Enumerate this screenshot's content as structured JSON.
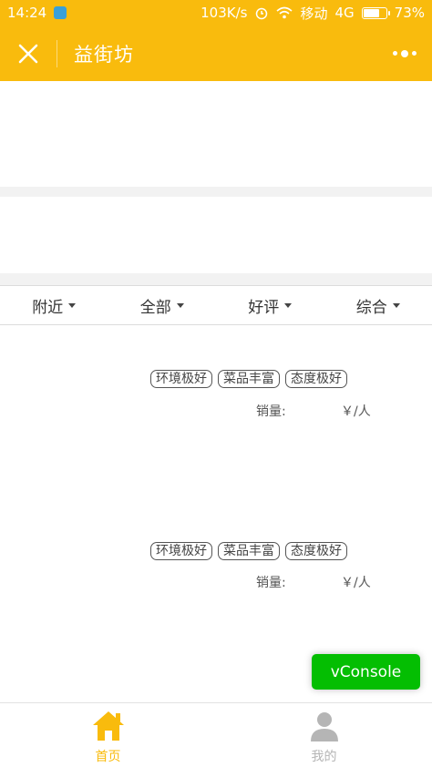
{
  "status_bar": {
    "time": "14:24",
    "net_speed": "103K/s",
    "carrier": "移动",
    "network": "4G",
    "battery_percent": 73,
    "battery_text": "73%"
  },
  "header": {
    "title": "益街坊"
  },
  "filters": [
    {
      "label": "附近"
    },
    {
      "label": "全部"
    },
    {
      "label": "好评"
    },
    {
      "label": "综合"
    }
  ],
  "shops": [
    {
      "tags": [
        "环境极好",
        "菜品丰富",
        "态度极好"
      ],
      "sales_label": "销量:",
      "price_label": "￥/人"
    },
    {
      "tags": [
        "环境极好",
        "菜品丰富",
        "态度极好"
      ],
      "sales_label": "销量:",
      "price_label": "￥/人"
    }
  ],
  "vconsole": {
    "label": "vConsole"
  },
  "tabbar": {
    "tabs": [
      {
        "label": "首页",
        "active": true
      },
      {
        "label": "我的",
        "active": false
      }
    ]
  },
  "colors": {
    "brand": "#f9bb0d",
    "tab_active": "#f9bb0d",
    "tab_inactive": "#b5b5b5",
    "vconsole": "#04be02"
  },
  "icons": [
    "close-icon",
    "more-icon",
    "home-icon",
    "user-icon",
    "alarm-icon",
    "wifi-icon",
    "signal-icon",
    "battery-icon"
  ]
}
